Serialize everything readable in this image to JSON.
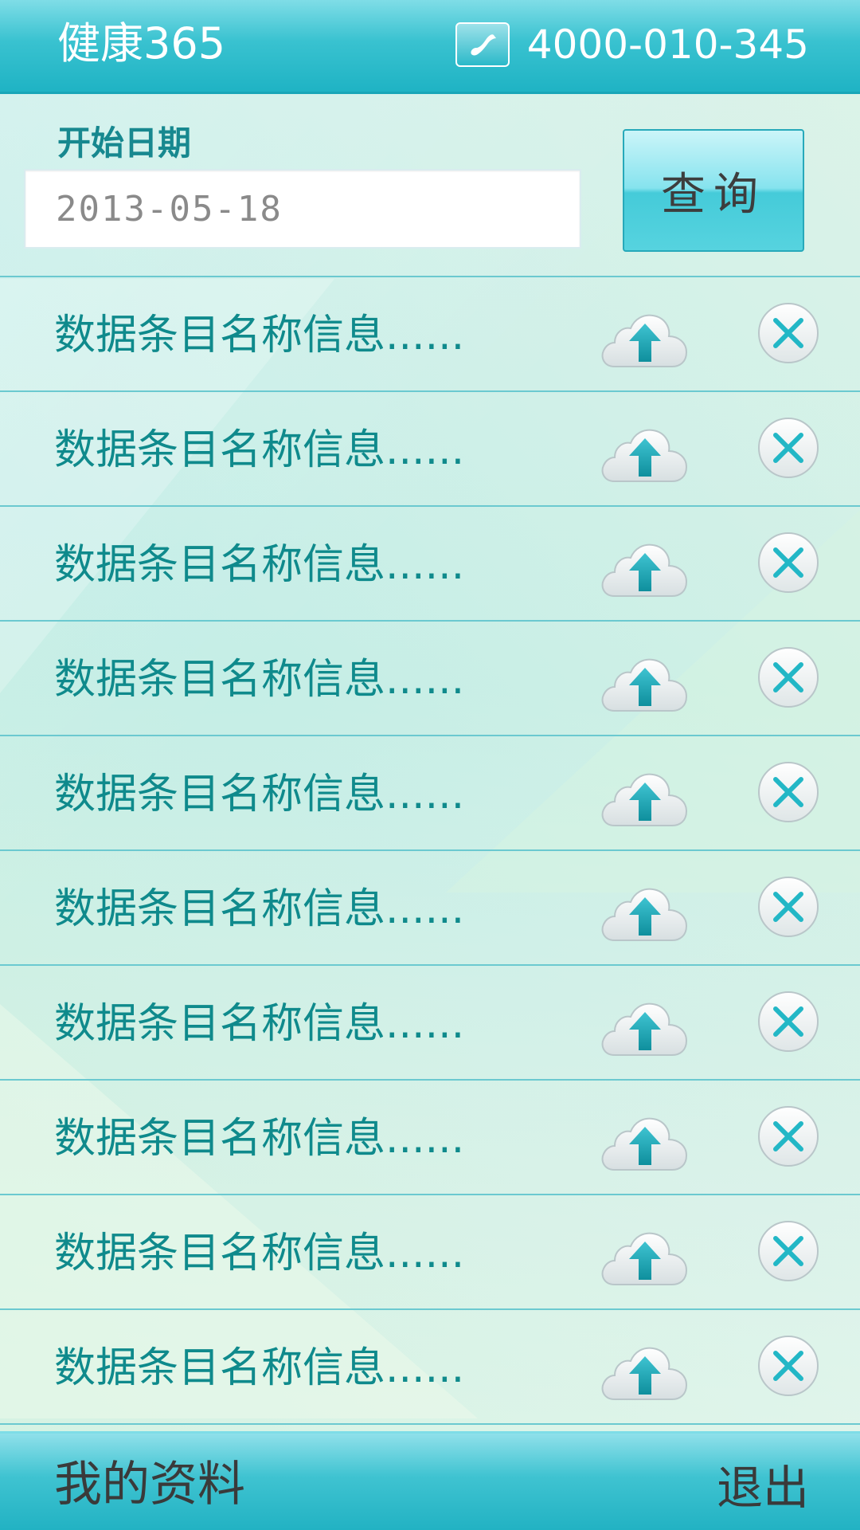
{
  "header": {
    "title": "健康365",
    "phone_icon": "phone-icon",
    "phone_number": "4000-010-345"
  },
  "query": {
    "start_date_label": "开始日期",
    "start_date_value": "2013-05-18",
    "query_button_label": "查询"
  },
  "list": {
    "items": [
      {
        "name": "数据条目名称信息......",
        "upload_icon": "cloud-upload-icon",
        "delete_icon": "close-circle-icon"
      },
      {
        "name": "数据条目名称信息......",
        "upload_icon": "cloud-upload-icon",
        "delete_icon": "close-circle-icon"
      },
      {
        "name": "数据条目名称信息......",
        "upload_icon": "cloud-upload-icon",
        "delete_icon": "close-circle-icon"
      },
      {
        "name": "数据条目名称信息......",
        "upload_icon": "cloud-upload-icon",
        "delete_icon": "close-circle-icon"
      },
      {
        "name": "数据条目名称信息......",
        "upload_icon": "cloud-upload-icon",
        "delete_icon": "close-circle-icon"
      },
      {
        "name": "数据条目名称信息......",
        "upload_icon": "cloud-upload-icon",
        "delete_icon": "close-circle-icon"
      },
      {
        "name": "数据条目名称信息......",
        "upload_icon": "cloud-upload-icon",
        "delete_icon": "close-circle-icon"
      },
      {
        "name": "数据条目名称信息......",
        "upload_icon": "cloud-upload-icon",
        "delete_icon": "close-circle-icon"
      },
      {
        "name": "数据条目名称信息......",
        "upload_icon": "cloud-upload-icon",
        "delete_icon": "close-circle-icon"
      },
      {
        "name": "数据条目名称信息......",
        "upload_icon": "cloud-upload-icon",
        "delete_icon": "close-circle-icon"
      }
    ]
  },
  "footer": {
    "profile_label": "我的资料",
    "logout_label": "退出"
  },
  "colors": {
    "header_bar": "#1fb3c4",
    "item_text": "#0f8a8c",
    "divider": "#6bc9d0",
    "button_accent": "#45cbd9"
  }
}
